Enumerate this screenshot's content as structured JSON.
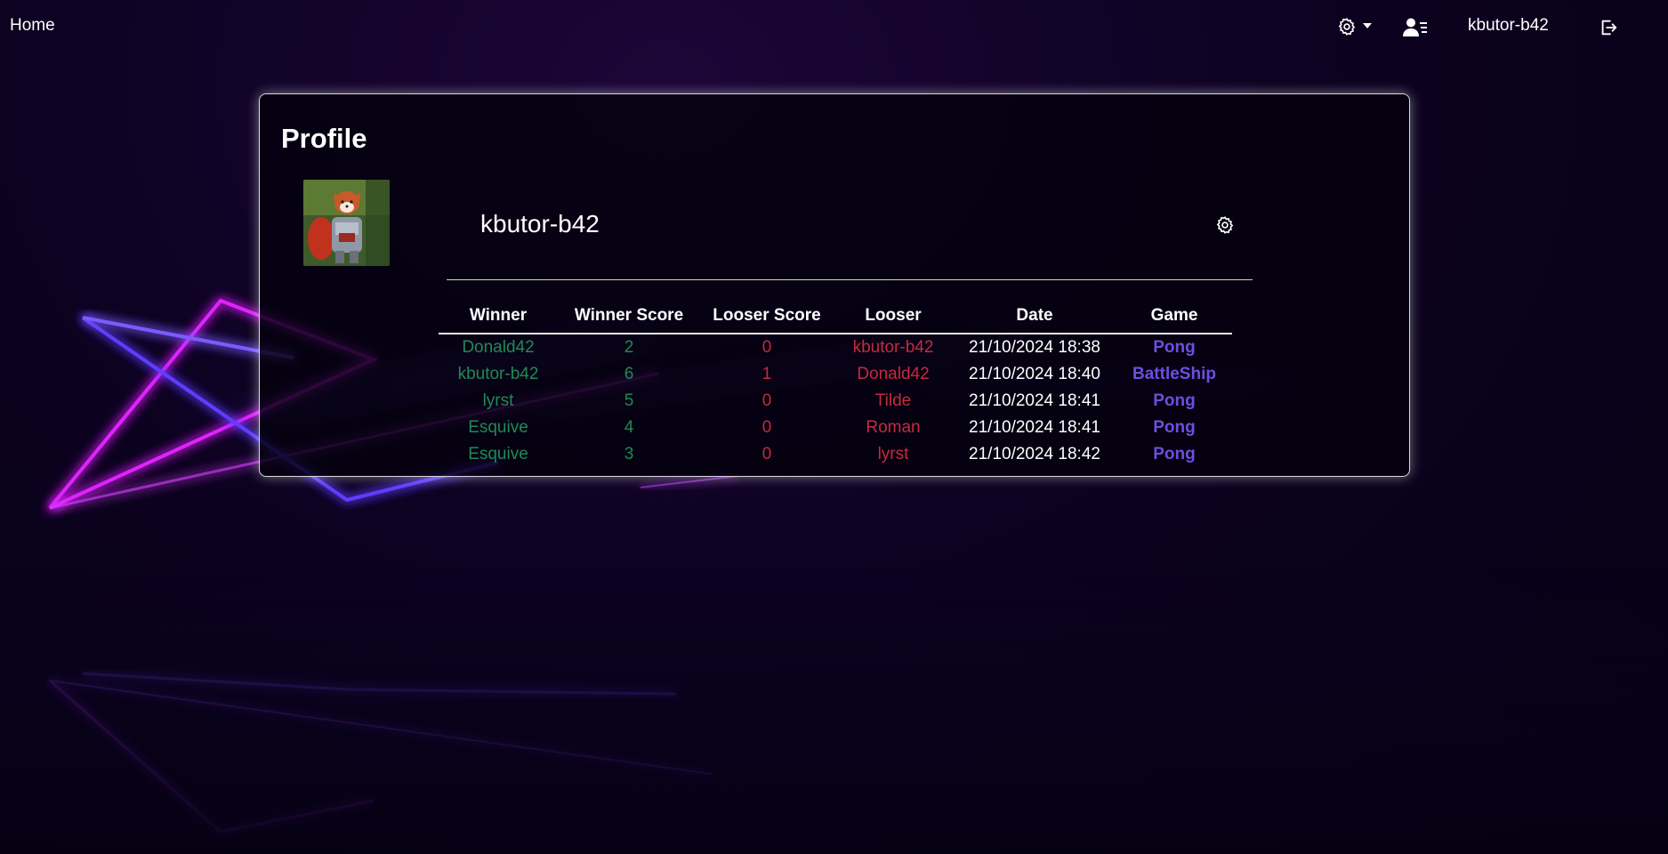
{
  "nav": {
    "home_label": "Home",
    "username": "kbutor-b42",
    "icons": [
      "gear-icon",
      "caret-down-icon",
      "user-list-icon",
      "logout-icon"
    ]
  },
  "profile": {
    "title": "Profile",
    "username": "kbutor-b42",
    "avatar": "red-panda-knight-avatar"
  },
  "history": {
    "headers": [
      "Winner",
      "Winner Score",
      "Looser Score",
      "Looser",
      "Date",
      "Game"
    ],
    "rows": [
      {
        "winner": "Donald42",
        "winner_score": "2",
        "looser_score": "0",
        "looser": "kbutor-b42",
        "date": "21/10/2024 18:38",
        "game": "Pong"
      },
      {
        "winner": "kbutor-b42",
        "winner_score": "6",
        "looser_score": "1",
        "looser": "Donald42",
        "date": "21/10/2024 18:40",
        "game": "BattleShip"
      },
      {
        "winner": "lyrst",
        "winner_score": "5",
        "looser_score": "0",
        "looser": "Tilde",
        "date": "21/10/2024 18:41",
        "game": "Pong"
      },
      {
        "winner": "Esquive",
        "winner_score": "4",
        "looser_score": "0",
        "looser": "Roman",
        "date": "21/10/2024 18:41",
        "game": "Pong"
      },
      {
        "winner": "Esquive",
        "winner_score": "3",
        "looser_score": "0",
        "looser": "lyrst",
        "date": "21/10/2024 18:42",
        "game": "Pong"
      }
    ]
  },
  "colors": {
    "winner": "#1f8a55",
    "looser": "#c52a3d",
    "game": "#6b4fe0",
    "background": "#0d0221"
  }
}
